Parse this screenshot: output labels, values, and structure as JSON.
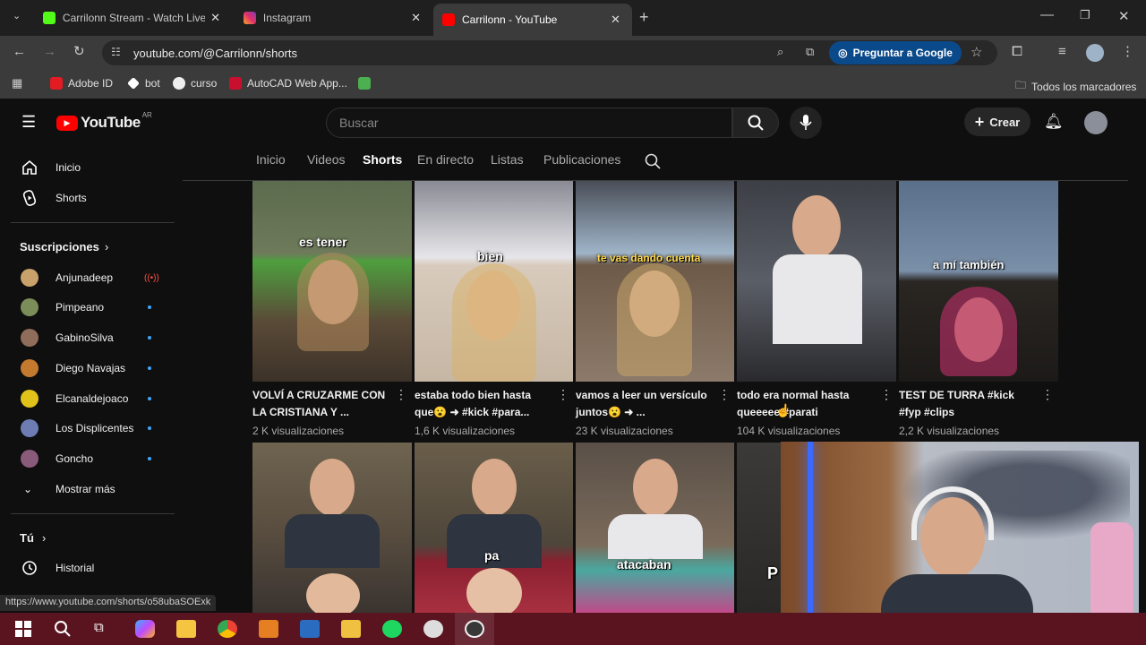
{
  "browser": {
    "tabs": [
      {
        "title": "Carrilonn Stream - Watch Live on",
        "favicon_color": "#53fc18"
      },
      {
        "title": "Instagram",
        "favicon_color": "#e1306c"
      },
      {
        "title": "Carrilonn - YouTube",
        "favicon_color": "#ff0000"
      }
    ],
    "url": "youtube.com/@Carrilonn/shorts",
    "ask_google": "Preguntar a Google",
    "bookmarks": [
      "Adobe ID",
      "bot",
      "curso",
      "AutoCAD Web App..."
    ],
    "all_bookmarks": "Todos los marcadores"
  },
  "youtube": {
    "logo_text": "YouTube",
    "region": "AR",
    "search_placeholder": "Buscar",
    "create_label": "Crear",
    "sidebar": {
      "main": [
        {
          "label": "Inicio",
          "icon": "home-icon"
        },
        {
          "label": "Shorts",
          "icon": "shorts-icon"
        }
      ],
      "subscriptions_header": "Suscripciones",
      "subscriptions": [
        {
          "label": "Anjunadeep",
          "color": "#c9a16b",
          "badge": "live"
        },
        {
          "label": "Pimpeano",
          "color": "#7b8e5a"
        },
        {
          "label": "GabinoSilva",
          "color": "#8f6d5a"
        },
        {
          "label": "Diego Navajas",
          "color": "#c47a2e"
        },
        {
          "label": "Elcanaldejoaco",
          "color": "#e0c21a"
        },
        {
          "label": "Los Displicentes",
          "color": "#6d7cb3"
        },
        {
          "label": "Goncho",
          "color": "#8a5a7a"
        }
      ],
      "show_more": "Mostrar más",
      "you_header": "Tú",
      "history": "Historial"
    },
    "channel_tabs": [
      "Inicio",
      "Videos",
      "Shorts",
      "En directo",
      "Listas",
      "Publicaciones"
    ],
    "active_tab": "Shorts",
    "shorts_row1": [
      {
        "title": "VOLVÍ A CRUZARME CON LA CRISTIANA Y ...",
        "views": "2 K visualizaciones",
        "caption": "es tener"
      },
      {
        "title": "estaba todo bien hasta que😮 ➜ #kick #para...",
        "views": "1,6 K visualizaciones",
        "caption": "bien"
      },
      {
        "title": "vamos a leer un versículo juntos😮 ➜ ...",
        "views": "23 K visualizaciones",
        "caption": "te vas dando cuenta"
      },
      {
        "title": "todo era normal hasta queeeee #parati",
        "views": "104 K visualizaciones",
        "caption": ""
      },
      {
        "title": "TEST DE TURRA #kick #fyp #clips",
        "views": "2,2 K visualizaciones",
        "caption": "a mí también"
      }
    ],
    "shorts_row2": [
      {
        "caption": ""
      },
      {
        "caption": "pa"
      },
      {
        "caption": "atacaban"
      },
      {
        "caption": "P"
      }
    ]
  },
  "status_url": "https://www.youtube.com/shorts/o58ubaSOExk"
}
